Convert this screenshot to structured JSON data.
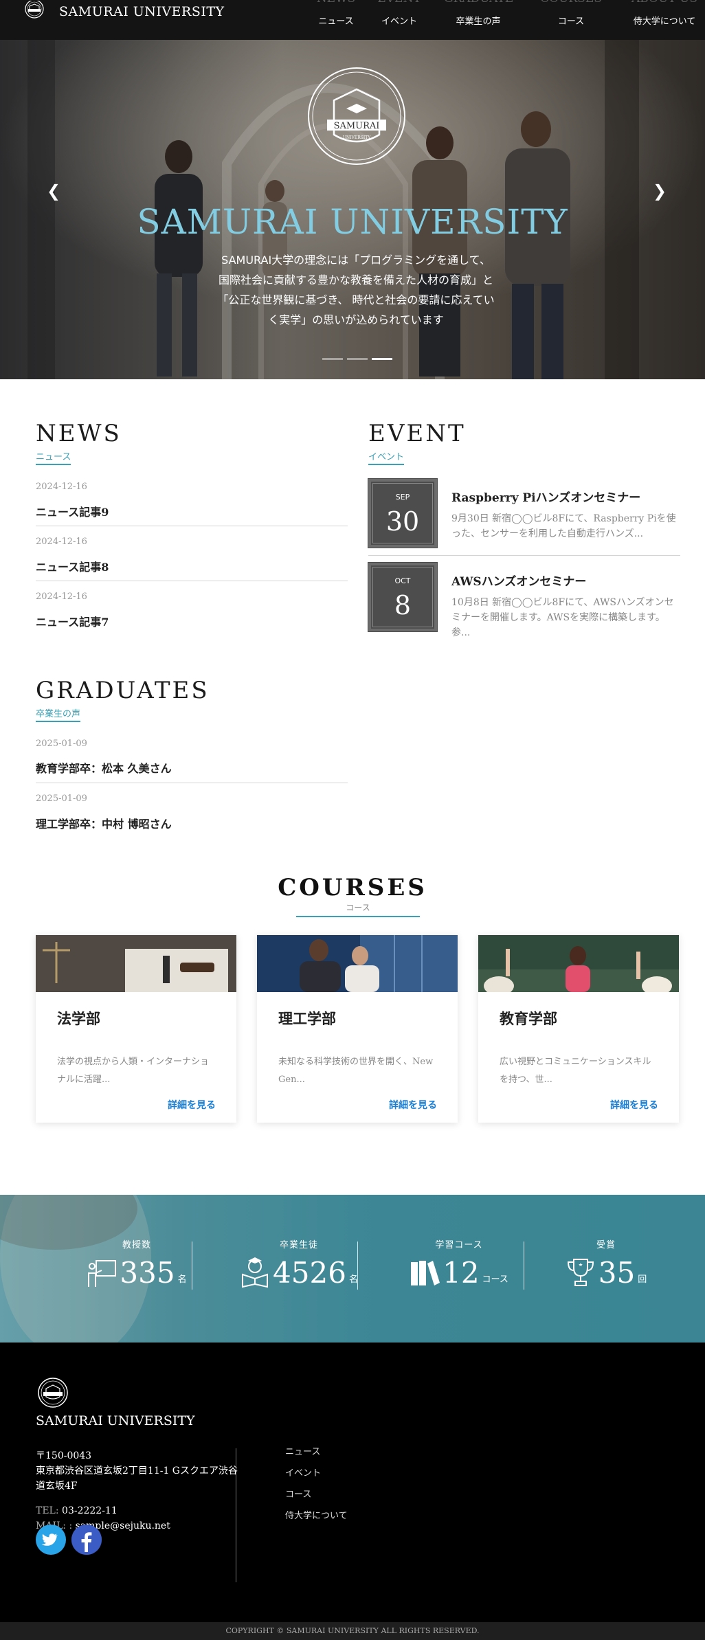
{
  "header": {
    "brand": "SAMURAI UNIVERSITY",
    "nav": [
      {
        "en": "NEWS",
        "ja": "ニュース"
      },
      {
        "en": "EVENT",
        "ja": "イベント"
      },
      {
        "en": "GRADUATES",
        "ja": "卒業生の声"
      },
      {
        "en": "COURSES",
        "ja": "コース"
      },
      {
        "en": "ABOUT US",
        "ja": "侍大学について"
      }
    ]
  },
  "hero": {
    "emblem_text": "SAMURAI",
    "emblem_sub": "UNIVERSITY",
    "title": "SAMURAI UNIVERSITY",
    "lines": [
      "SAMURAI大学の理念には「プログラミングを通して、",
      "国際社会に貢献する豊かな教養を備えた人材の育成」と",
      "「公正な世界観に基づき、 時代と社会の要請に応えてい",
      "く実学」の思いが込められています"
    ],
    "prev_glyph": "❮",
    "next_glyph": "❯",
    "slides": 3,
    "active_slide": 3
  },
  "news": {
    "title": "NEWS",
    "subtitle": "ニュース",
    "items": [
      {
        "date": "2024-12-16",
        "title": "ニュース記事9"
      },
      {
        "date": "2024-12-16",
        "title": "ニュース記事8"
      },
      {
        "date": "2024-12-16",
        "title": "ニュース記事7"
      }
    ]
  },
  "event": {
    "title": "EVENT",
    "subtitle": "イベント",
    "items": [
      {
        "month": "SEP",
        "day": "30",
        "title": "Raspberry Piハンズオンセミナー",
        "desc": "9月30日 新宿◯◯ビル8Fにて、Raspberry Piを使った、センサーを利用した自動走行ハンズ..."
      },
      {
        "month": "OCT",
        "day": "8",
        "title": "AWSハンズオンセミナー",
        "desc": "10月8日 新宿◯◯ビル8Fにて、AWSハンズオンセミナーを開催します。AWSを実際に構築します。参..."
      }
    ]
  },
  "graduates": {
    "title": "GRADUATES",
    "subtitle": "卒業生の声",
    "items": [
      {
        "date": "2025-01-09",
        "title": "教育学部卒：松本 久美さん"
      },
      {
        "date": "2025-01-09",
        "title": "理工学部卒：中村 博昭さん"
      }
    ]
  },
  "courses": {
    "title": "COURSES",
    "subtitle": "コース",
    "link_label": "詳細を見る",
    "items": [
      {
        "title": "法学部",
        "desc": "法学の視点から人類・インターナショナルに活躍..."
      },
      {
        "title": "理工学部",
        "desc": "未知なる科学技術の世界を開く、New Gen..."
      },
      {
        "title": "教育学部",
        "desc": "広い視野とコミュニケーションスキルを持つ、世..."
      }
    ]
  },
  "stats": [
    {
      "label": "教授数",
      "value": "335",
      "unit": "名",
      "icon": "teacher-board-icon"
    },
    {
      "label": "卒業生徒",
      "value": "4526",
      "unit": "名",
      "icon": "graduate-reading-icon"
    },
    {
      "label": "学習コース",
      "value": "12",
      "unit": "コース",
      "icon": "books-icon"
    },
    {
      "label": "受賞",
      "value": "35",
      "unit": "回",
      "icon": "trophy-icon"
    }
  ],
  "footer": {
    "name": "SAMURAI UNIVERSITY",
    "postal": "〒150-0043",
    "address": "東京都渋谷区道玄坂2丁目11-1 Gスクエア渋谷道玄坂4F",
    "tel_label": "TEL:",
    "tel": "03-2222-11",
    "mail_label": "MAIL: :",
    "mail": "sample@sejuku.net",
    "links": [
      "ニュース",
      "イベント",
      "コース",
      "侍大学について"
    ],
    "copyright": "COPYRIGHT © SAMURAI UNIVERSITY ALL RIGHTS RESERVED."
  },
  "colors": {
    "accent": "#3aa0b6",
    "hero_title": "#83cde3",
    "link": "#1a7fd6",
    "stats_bg": "#3c8796"
  }
}
